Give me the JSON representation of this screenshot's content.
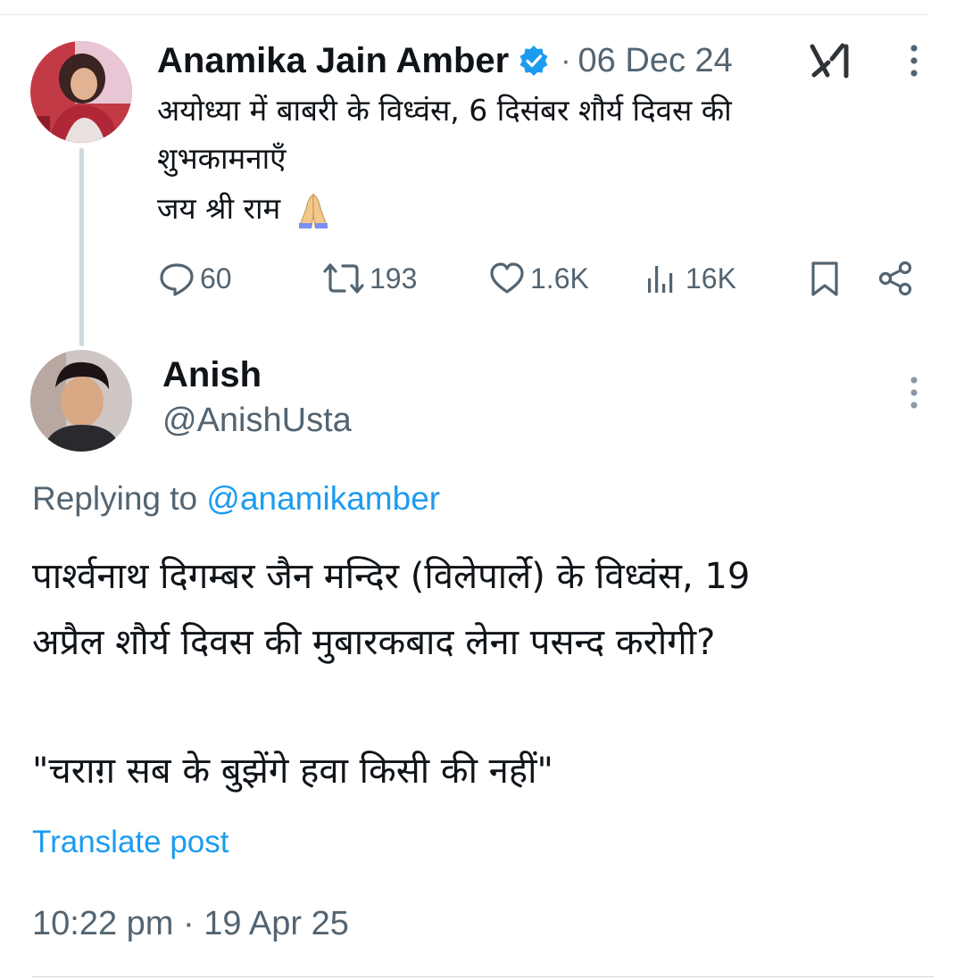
{
  "original_post": {
    "author_name": "Anamika Jain Amber",
    "separator": "·",
    "date": "06 Dec 24",
    "text_line1": "अयोध्या में बाबरी  के विध्वंस, 6 दिसंबर शौर्य दिवस की",
    "text_line2": "शुभकामनाएँ",
    "text_line3": "जय श्री राम",
    "emoji": "folded-hands",
    "stats": {
      "replies": "60",
      "reposts": "193",
      "likes": "1.6K",
      "views": "16K"
    }
  },
  "reply_post": {
    "author_name": "Anish",
    "handle": "@AnishUsta",
    "replying_prefix": "Replying to ",
    "replying_to": "@anamikamber",
    "text_line1": "पार्श्वनाथ दिगम्बर जैन मन्दिर (विलेपार्ले) के विध्वंस, 19",
    "text_line2": "अप्रैल शौर्य दिवस की मुबारकबाद लेना पसन्द करोगी?",
    "text_line3": "\"चराग़ सब के बुझेंगे हवा किसी की नहीं\"",
    "translate_label": "Translate post",
    "timestamp": "10:22 pm · 19 Apr 25"
  },
  "colors": {
    "text_primary": "#0f1419",
    "text_secondary": "#536471",
    "link_blue": "#1d9bf0",
    "divider": "#cfd9de"
  },
  "icons": {
    "verified": "verified-badge-icon",
    "logo": "grok-icon",
    "more": "more-icon",
    "reply": "reply-icon",
    "repost": "repost-icon",
    "like": "heart-icon",
    "views": "views-icon",
    "bookmark": "bookmark-icon",
    "share": "share-icon"
  }
}
